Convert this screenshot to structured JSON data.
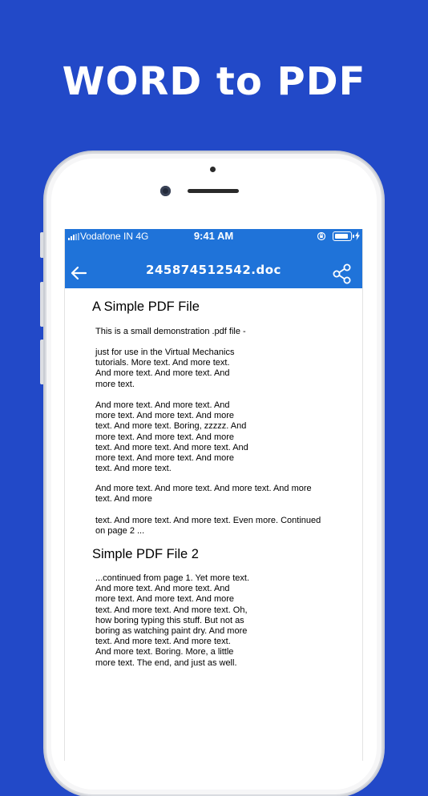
{
  "banner": {
    "title": "WORD to PDF"
  },
  "status_bar": {
    "carrier": "Vodafone IN 4G",
    "time": "9:41 AM"
  },
  "app_bar": {
    "back_icon": "arrow-left-icon",
    "title": "245874512542.doc",
    "share_icon": "share-icon"
  },
  "document": {
    "heading1": "A Simple PDF File",
    "p1": "This is a small demonstration .pdf file -",
    "p2": "just for use in the Virtual Mechanics\ntutorials. More text. And more text.\nAnd more text. And more text. And\nmore text.",
    "p3": "And more text. And more text. And\nmore text. And more text. And more\ntext. And more text. Boring, zzzzz. And\nmore text. And more text. And more\ntext. And more text. And more text. And\nmore text. And more text. And more\ntext. And more text.",
    "p4": "And more text. And more text. And more text. And more\ntext. And more",
    "p5": "text. And more text. And more text. Even more. Continued\non page 2 ...",
    "heading2": "Simple PDF File 2",
    "p6": "...continued from page 1. Yet more text.\nAnd more text. And more text. And\nmore text. And more text. And more\ntext. And more text. And more text. Oh,\nhow boring typing this stuff. But not as\nboring as watching paint dry. And more\ntext. And more text. And more text.\nAnd more text. Boring. More, a little\nmore text. The end, and just as well."
  },
  "colors": {
    "background": "#2249c8",
    "app_bar": "#1f73d9",
    "text": "#000000"
  }
}
